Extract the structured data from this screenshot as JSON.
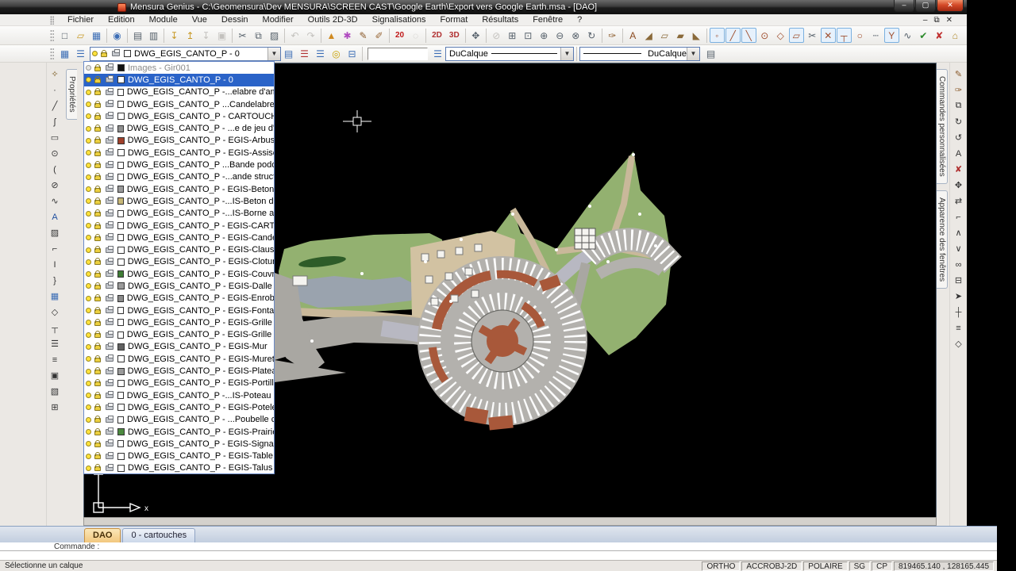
{
  "window": {
    "title": "Mensura Genius - C:\\Geomensura\\Dev MENSURA\\SCREEN CAST\\Google Earth\\Export vers Google Earth.msa - [DAO]",
    "controls": {
      "minimize": "–",
      "maximize": "▢",
      "close": "✕"
    },
    "child_controls": {
      "minimize": "–",
      "restore": "⧉",
      "close": "✕"
    }
  },
  "menu": {
    "items": [
      "Fichier",
      "Edition",
      "Module",
      "Vue",
      "Dessin",
      "Modifier",
      "Outils 2D-3D",
      "Signalisations",
      "Format",
      "Résultats",
      "Fenêtre",
      "?"
    ]
  },
  "toolbar1": {
    "groups": [
      [
        [
          "new-document",
          "□",
          "#55606a"
        ],
        [
          "open-folder",
          "▱",
          "#c89a28"
        ],
        [
          "save",
          "▦",
          "#3b6db5"
        ]
      ],
      [
        [
          "view-scene",
          "◉",
          "#3b6db5"
        ]
      ],
      [
        [
          "print",
          "▤",
          "#55606a"
        ],
        [
          "print-preview",
          "▥",
          "#55606a"
        ]
      ],
      [
        [
          "import-file",
          "↧",
          "#c89a28"
        ],
        [
          "export-file",
          "↥",
          "#c89a28"
        ],
        [
          "import-image",
          "↧",
          "",
          [
            "d"
          ]
        ],
        [
          "capture-view",
          "▣",
          "",
          [
            "d"
          ]
        ]
      ],
      [
        [
          "cut",
          "✂",
          "#55606a"
        ],
        [
          "copy",
          "⧉",
          "#55606a"
        ],
        [
          "paste",
          "▨",
          "#55606a"
        ]
      ],
      [
        [
          "undo",
          "↶",
          "",
          [
            "d"
          ]
        ],
        [
          "redo",
          "↷",
          "",
          [
            "d"
          ]
        ]
      ],
      [
        [
          "signal-cone",
          "▲",
          "#d08a20"
        ],
        [
          "color-palette",
          "✱",
          "#b04ac0"
        ],
        [
          "brush",
          "✎",
          "#8a5a2a"
        ],
        [
          "style-brush",
          "✐",
          "#9a6a3a"
        ]
      ],
      [
        [
          "scale-label",
          "20",
          "#c01818",
          [
            "t"
          ]
        ],
        [
          "pick-cursor",
          "◌",
          "#999",
          [
            "d"
          ]
        ]
      ],
      [
        [
          "mode-2d",
          "2D",
          "#b03030",
          [
            "t"
          ]
        ],
        [
          "mode-3d",
          "3D",
          "#b03030",
          [
            "t"
          ]
        ]
      ],
      [
        [
          "pan",
          "✥",
          "#55606a"
        ]
      ],
      [
        [
          "zoom-previous",
          "⊘",
          "",
          [
            "d"
          ]
        ],
        [
          "zoom-window",
          "⊞",
          "#55606a"
        ],
        [
          "zoom-object",
          "⊡",
          "#55606a"
        ],
        [
          "zoom-in",
          "⊕",
          "#55606a"
        ],
        [
          "zoom-out",
          "⊖",
          "#55606a"
        ],
        [
          "zoom-selection",
          "⊗",
          "#55606a"
        ],
        [
          "zoom-extents",
          "↻",
          "#55606a"
        ]
      ],
      [
        [
          "quick-pen",
          "✑",
          "#8a5a2a"
        ]
      ],
      [
        [
          "annotate-text",
          "A",
          "#8a4a1f"
        ],
        [
          "draw-slope",
          "◢",
          "#8a6a3a"
        ],
        [
          "draw-parcel",
          "▱",
          "#8a6a3a"
        ],
        [
          "draw-surface",
          "▰",
          "#8a6a3a"
        ],
        [
          "draw-profile",
          "◣",
          "#8a6a3a"
        ]
      ],
      [
        [
          "snap-point",
          "◦",
          "#a05030",
          [
            "b"
          ]
        ],
        [
          "snap-segment",
          "╱",
          "#a05030",
          [
            "b"
          ]
        ],
        [
          "snap-extremity",
          "╲",
          "#a05030",
          [
            "b"
          ]
        ],
        [
          "snap-center",
          "⊙",
          "#a05030"
        ],
        [
          "snap-quadrant",
          "◇",
          "#a05030"
        ],
        [
          "snap-parallel",
          "▱",
          "#a05030",
          [
            "b"
          ]
        ],
        [
          "snap-cut",
          "✂",
          "#55606a"
        ],
        [
          "snap-intersection",
          "✕",
          "#a05030",
          [
            "b"
          ]
        ],
        [
          "snap-perpendicular",
          "┬",
          "#a05030",
          [
            "b"
          ]
        ],
        [
          "snap-tangent",
          "○",
          "#a05030"
        ],
        [
          "snap-axis",
          "┄",
          "#55606a"
        ],
        [
          "snap-node",
          "Y",
          "#a05030",
          [
            "b"
          ]
        ],
        [
          "snap-wave",
          "∿",
          "#55606a"
        ],
        [
          "apply-on",
          "✔",
          "#2a8a2a"
        ],
        [
          "apply-off",
          "✘",
          "#c03030"
        ],
        [
          "snap-roof",
          "⌂",
          "#b08a2a"
        ]
      ]
    ]
  },
  "toolbar2": {
    "left_icons": [
      [
        "window-settings",
        "▦",
        "#3b6db5"
      ],
      [
        "layers-manager",
        "☰",
        "#3b6db5"
      ]
    ],
    "layer_combo": {
      "value": "DWG_EGIS_CANTO_P - 0",
      "swatch": "#ffffff"
    },
    "mid_icons": [
      [
        "layer-freeze",
        "▤",
        "#3b6db5"
      ],
      [
        "layers-delete",
        "☰",
        "#b03030"
      ],
      [
        "layers-all",
        "☰",
        "#3b6db5"
      ],
      [
        "layer-lamp",
        "◎",
        "#c8a200"
      ],
      [
        "layer-transfer",
        "⊟",
        "#3b6db5"
      ]
    ],
    "color_field_value": "",
    "layer_arrow_icon": [
      "layer-apply",
      "☰",
      "#3b6db5"
    ],
    "linetype_combo": "DuCalque",
    "lineweight_combo": "DuCalque",
    "right_icon": [
      "plot-style",
      "▤",
      "#55606a"
    ]
  },
  "left_tab": "Propriétés",
  "right_tabs": [
    "Commandes personnalisées",
    "Apparence des fenêtres"
  ],
  "left_tools": [
    [
      "draw-wand",
      "✧",
      "#7a5a1f"
    ],
    [
      "draw-point",
      "·",
      "#333"
    ],
    [
      "draw-line",
      "╱",
      "#333"
    ],
    [
      "draw-polyline",
      "ʃ",
      "#333"
    ],
    [
      "draw-rectangle",
      "▭",
      "#333"
    ],
    [
      "draw-circle",
      "⊙",
      "#333"
    ],
    [
      "draw-arc",
      "(",
      "#333"
    ],
    [
      "draw-ellipse",
      "⊘",
      "#333"
    ],
    [
      "draw-spline",
      "∿",
      "#333"
    ],
    [
      "draw-text",
      "A",
      "#1f4f9f"
    ],
    [
      "draw-hatch",
      "▨",
      "#333"
    ],
    [
      "draw-corner",
      "⌐",
      "#333"
    ],
    [
      "draw-dimension",
      "I",
      "#333"
    ],
    [
      "draw-leader",
      "}",
      "#333"
    ],
    [
      "draw-grid",
      "▦",
      "#3b6db5"
    ],
    [
      "draw-diamond",
      "◇",
      "#333"
    ],
    [
      "draw-table",
      "┬",
      "#333"
    ],
    [
      "draw-list",
      "☰",
      "#333"
    ],
    [
      "draw-offset",
      "≡",
      "#333"
    ],
    [
      "draw-block",
      "▣",
      "#333"
    ],
    [
      "draw-image",
      "▧",
      "#333"
    ],
    [
      "draw-group",
      "⊞",
      "#333"
    ]
  ],
  "right_tools": [
    [
      "format-painter",
      "✎",
      "#8a5a2a"
    ],
    [
      "brush-style",
      "✑",
      "#8a5a2a"
    ],
    [
      "copy-object",
      "⧉",
      "#333"
    ],
    [
      "rotate",
      "↻",
      "#333"
    ],
    [
      "rotate-copy",
      "↺",
      "#333"
    ],
    [
      "text-edit",
      "A",
      "#333"
    ],
    [
      "erase",
      "✘",
      "#b03030"
    ],
    [
      "move",
      "✥",
      "#333"
    ],
    [
      "stretch",
      "⇄",
      "#333"
    ],
    [
      "corner-edit",
      "⌐",
      "#333"
    ],
    [
      "mirror-vertical",
      "∧",
      "#333"
    ],
    [
      "mirror-horizontal",
      "∨",
      "#333"
    ],
    [
      "attach",
      "∞",
      "#333"
    ],
    [
      "display-order",
      "⊟",
      "#333"
    ],
    [
      "select",
      "➤",
      "#333"
    ],
    [
      "measure",
      "┼",
      "#333"
    ],
    [
      "align",
      "≡",
      "#333"
    ],
    [
      "node-edit",
      "◇",
      "#333"
    ]
  ],
  "layer_list": {
    "rows": [
      {
        "label": "Images - Gir001",
        "swatch": "#111111",
        "dim": true
      },
      {
        "label": "DWG_EGIS_CANTO_P - 0",
        "swatch": "#ffffff",
        "selected": true
      },
      {
        "label": "DWG_EGIS_CANTO_P -...elabre d'ambiance",
        "swatch": "#ffffff"
      },
      {
        "label": "DWG_EGIS_CANTO_P ...Candelabre double",
        "swatch": "#ffffff"
      },
      {
        "label": "DWG_EGIS_CANTO_P - CARTOUCHE",
        "swatch": "#ffffff"
      },
      {
        "label": "DWG_EGIS_CANTO_P - ...e de jeu d'enfants",
        "swatch": "#8f8f8f"
      },
      {
        "label": "DWG_EGIS_CANTO_P - EGIS-Arbustif",
        "swatch": "#a0402a"
      },
      {
        "label": "DWG_EGIS_CANTO_P - EGIS-Assise",
        "swatch": "#ffffff"
      },
      {
        "label": "DWG_EGIS_CANTO_P ...Bande pododactile",
        "swatch": "#ffffff"
      },
      {
        "label": "DWG_EGIS_CANTO_P -...ande structurante",
        "swatch": "#ffffff"
      },
      {
        "label": "DWG_EGIS_CANTO_P - EGIS-Beton balaye",
        "swatch": "#9a9a9a"
      },
      {
        "label": "DWG_EGIS_CANTO_P -...IS-Beton desactive",
        "swatch": "#c8b878"
      },
      {
        "label": "DWG_EGIS_CANTO_P -...IS-Borne amovible",
        "swatch": "#ffffff"
      },
      {
        "label": "DWG_EGIS_CANTO_P - EGIS-CARTOUCHE",
        "swatch": "#ffffff"
      },
      {
        "label": "DWG_EGIS_CANTO_P - EGIS-Candelabre",
        "swatch": "#ffffff"
      },
      {
        "label": "DWG_EGIS_CANTO_P - EGIS-Claustra",
        "swatch": "#ffffff"
      },
      {
        "label": "DWG_EGIS_CANTO_P - EGIS-Cloture",
        "swatch": "#ffffff"
      },
      {
        "label": "DWG_EGIS_CANTO_P - EGIS-Couvre sol",
        "swatch": "#3f7d35"
      },
      {
        "label": "DWG_EGIS_CANTO_P - EGIS-Dalle",
        "swatch": "#9a9a9a"
      },
      {
        "label": "DWG_EGIS_CANTO_P - EGIS-Enrobe voirie",
        "swatch": "#8a8a8a"
      },
      {
        "label": "DWG_EGIS_CANTO_P - EGIS-Fontaine",
        "swatch": "#ffffff"
      },
      {
        "label": "DWG_EGIS_CANTO_P - EGIS-Grille EP",
        "swatch": "#ffffff"
      },
      {
        "label": "DWG_EGIS_CANTO_P - EGIS-Grille d'arbre",
        "swatch": "#ffffff"
      },
      {
        "label": "DWG_EGIS_CANTO_P - EGIS-Mur",
        "swatch": "#606060"
      },
      {
        "label": "DWG_EGIS_CANTO_P - EGIS-Muret",
        "swatch": "#ffffff"
      },
      {
        "label": "DWG_EGIS_CANTO_P - EGIS-Plateau",
        "swatch": "#9a9a9a"
      },
      {
        "label": "DWG_EGIS_CANTO_P - EGIS-Portillon",
        "swatch": "#ffffff"
      },
      {
        "label": "DWG_EGIS_CANTO_P -...IS-Poteau pergolat",
        "swatch": "#ffffff"
      },
      {
        "label": "DWG_EGIS_CANTO_P - EGIS-Potelet",
        "swatch": "#ffffff"
      },
      {
        "label": "DWG_EGIS_CANTO_P - ...Poubelle collectif",
        "swatch": "#ffffff"
      },
      {
        "label": "DWG_EGIS_CANTO_P - EGIS-Prairie",
        "swatch": "#4c8a3f"
      },
      {
        "label": "DWG_EGIS_CANTO_P - EGIS-Signalisation",
        "swatch": "#ffffff"
      },
      {
        "label": "DWG_EGIS_CANTO_P - EGIS-Table",
        "swatch": "#ffffff"
      },
      {
        "label": "DWG_EGIS_CANTO_P - EGIS-Talus",
        "swatch": "#ffffff"
      }
    ]
  },
  "canvas": {
    "ucs_label": "x",
    "map": {
      "green": "#93b170",
      "green_dark": "#2e5c28",
      "tan": "#c9b89a",
      "plaza": "#d2c2a2",
      "road": "#a9a7a2",
      "road_light": "#b8b8c2",
      "water": "#9aa3ae",
      "parking": "#b3b1ad",
      "stripe": "#ffffff",
      "terra": "#a8583a",
      "building": "#f5f4f0",
      "outline": "#6a6a66"
    }
  },
  "doc_tabs": [
    {
      "label": "DAO",
      "active": true
    },
    {
      "label": "0 - cartouches",
      "active": false
    }
  ],
  "command": {
    "prompt": "Commande :",
    "input": ""
  },
  "statusbar": {
    "message": "Sélectionne un calque",
    "fields": [
      "ORTHO",
      "ACCROBJ-2D",
      "POLAIRE",
      "SG",
      "CP"
    ],
    "coords": "819465.140 , 128165.445"
  }
}
